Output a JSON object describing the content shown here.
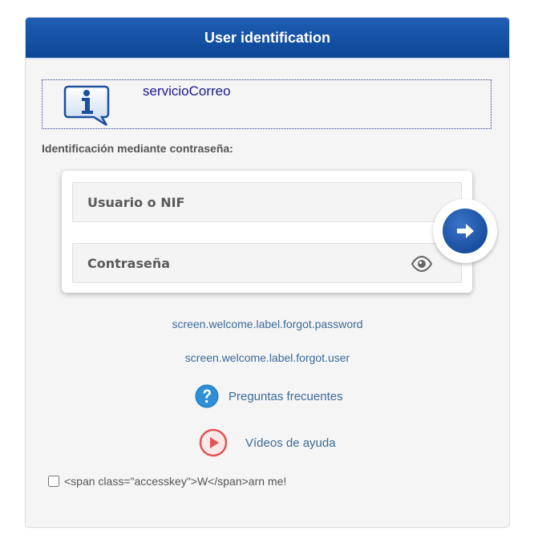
{
  "header": {
    "title": "User identification"
  },
  "info": {
    "icon": "info-icon",
    "text": "servicioCorreo"
  },
  "login": {
    "section_label": "Identificación mediante contraseña:",
    "user_placeholder": "Usuario o NIF",
    "password_placeholder": "Contraseña",
    "user_value": "",
    "password_value": "",
    "eye_icon": "eye-icon",
    "submit_icon": "arrow-right-icon"
  },
  "links": {
    "forgot_password": "screen.welcome.label.forgot.password",
    "forgot_user": "screen.welcome.label.forgot.user"
  },
  "help": {
    "faq_label": "Preguntas frecuentes",
    "faq_icon": "question-icon",
    "videos_label": "Vídeos de ayuda",
    "videos_icon": "play-icon"
  },
  "remember": {
    "label": "<span class=\"accesskey\">W</span>arn me!",
    "checked": false
  },
  "colors": {
    "header": "#0c4596",
    "link": "#3a6a9a",
    "info_text": "#1a1a8c",
    "play_red": "#e05555",
    "faq_blue": "#2d8fd5"
  }
}
